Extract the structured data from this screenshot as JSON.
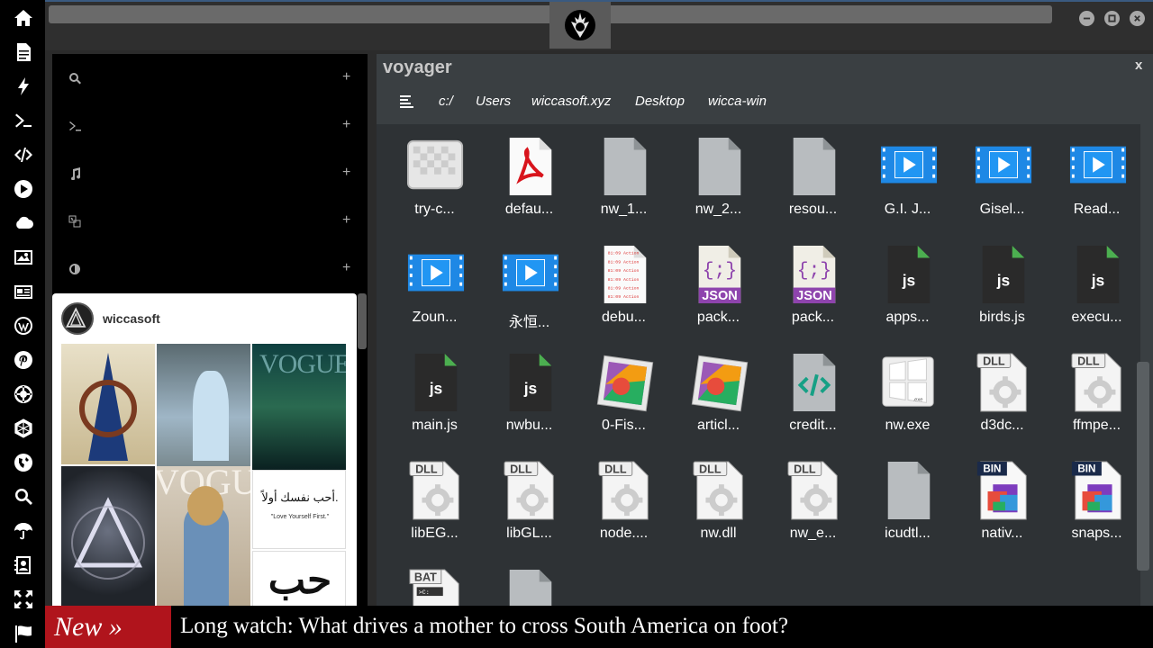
{
  "sidebar": {
    "icons": [
      "home-icon",
      "document-icon",
      "bolt-icon",
      "terminal-icon",
      "code-icon",
      "play-icon",
      "cloud-icon",
      "image-icon",
      "news-icon",
      "wordpress-icon",
      "pinterest-icon",
      "empire-icon",
      "globe-wire-icon",
      "globe-icon",
      "search-icon",
      "umbrella-icon",
      "contact-icon",
      "expand-icon",
      "flag-icon"
    ]
  },
  "left_panel": {
    "rows": [
      {
        "icon": "search-icon",
        "plus": "+"
      },
      {
        "icon": "terminal-icon",
        "plus": "+"
      },
      {
        "icon": "music-icon",
        "plus": "+"
      },
      {
        "icon": "translate-icon",
        "plus": "+"
      },
      {
        "icon": "contrast-icon",
        "plus": "+"
      }
    ],
    "feed": {
      "username": "wiccasoft"
    }
  },
  "voyager": {
    "title": "voyager",
    "close": "x",
    "breadcrumb": [
      "c:/",
      "Users",
      "wiccasoft.xyz",
      "Desktop",
      "wicca-win"
    ],
    "files": [
      {
        "name": "try-c...",
        "type": "transparent"
      },
      {
        "name": "defau...",
        "type": "pdf"
      },
      {
        "name": "nw_1...",
        "type": "blank"
      },
      {
        "name": "nw_2...",
        "type": "blank"
      },
      {
        "name": "resou...",
        "type": "blank"
      },
      {
        "name": "G.I. J...",
        "type": "video"
      },
      {
        "name": "Gisel...",
        "type": "video"
      },
      {
        "name": "Read...",
        "type": "video"
      },
      {
        "name": "Zoun...",
        "type": "video"
      },
      {
        "name": "永恒...",
        "type": "video"
      },
      {
        "name": "debu...",
        "type": "log"
      },
      {
        "name": "pack...",
        "type": "json"
      },
      {
        "name": "pack...",
        "type": "json"
      },
      {
        "name": "apps...",
        "type": "js"
      },
      {
        "name": "birds.js",
        "type": "js"
      },
      {
        "name": "execu...",
        "type": "js"
      },
      {
        "name": "main.js",
        "type": "js"
      },
      {
        "name": "nwbu...",
        "type": "js"
      },
      {
        "name": "0-Fis...",
        "type": "picture"
      },
      {
        "name": "articl...",
        "type": "picture"
      },
      {
        "name": "credit...",
        "type": "code"
      },
      {
        "name": "nw.exe",
        "type": "exe"
      },
      {
        "name": "d3dc...",
        "type": "dll"
      },
      {
        "name": "ffmpe...",
        "type": "dll"
      },
      {
        "name": "libEG...",
        "type": "dll"
      },
      {
        "name": "libGL...",
        "type": "dll"
      },
      {
        "name": "node....",
        "type": "dll"
      },
      {
        "name": "nw.dll",
        "type": "dll"
      },
      {
        "name": "nw_e...",
        "type": "dll"
      },
      {
        "name": "icudtl...",
        "type": "blank"
      },
      {
        "name": "nativ...",
        "type": "bin"
      },
      {
        "name": "snaps...",
        "type": "bin"
      },
      {
        "name": "",
        "type": "bat"
      },
      {
        "name": "",
        "type": "blank"
      }
    ]
  },
  "ticker": {
    "badge": "New »",
    "headline": "Long watch: What drives a mother to cross South America on foot?"
  },
  "colors": {
    "accent": "#3a5a80",
    "ticker_red": "#b0141c",
    "video_blue": "#1e88e5",
    "js_green": "#4caf50",
    "json_purple": "#8e44ad"
  }
}
